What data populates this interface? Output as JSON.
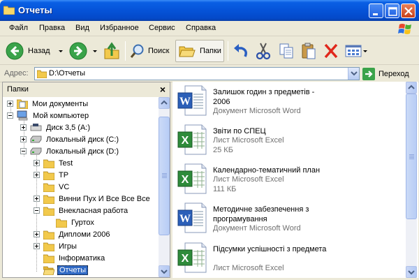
{
  "window": {
    "title": "Отчеты"
  },
  "menu": [
    "Файл",
    "Правка",
    "Вид",
    "Избранное",
    "Сервис",
    "Справка"
  ],
  "toolbar": {
    "back_label": "Назад",
    "search_label": "Поиск",
    "folders_label": "Папки"
  },
  "address": {
    "label": "Адрес:",
    "value": "D:\\Отчеты",
    "go_label": "Переход"
  },
  "folders_pane": {
    "title": "Папки",
    "items": [
      {
        "label": "Мои документы",
        "icon": "my-documents-icon"
      },
      {
        "label": "Мой компьютер",
        "icon": "my-computer-icon"
      },
      {
        "label": "Диск 3,5 (A:)",
        "icon": "floppy-drive-icon"
      },
      {
        "label": "Локальный диск (C:)",
        "icon": "hard-drive-icon"
      },
      {
        "label": "Локальный диск (D:)",
        "icon": "hard-drive-icon"
      },
      {
        "label": "Test",
        "icon": "folder-icon"
      },
      {
        "label": "TP",
        "icon": "folder-icon"
      },
      {
        "label": "VC",
        "icon": "folder-icon"
      },
      {
        "label": "Винни Пух И Все Все Все",
        "icon": "folder-icon"
      },
      {
        "label": "Внекласная работа",
        "icon": "folder-icon"
      },
      {
        "label": "Гуртох",
        "icon": "folder-icon"
      },
      {
        "label": "Дипломи 2006",
        "icon": "folder-icon"
      },
      {
        "label": "Игры",
        "icon": "folder-icon"
      },
      {
        "label": "Інформатика",
        "icon": "folder-icon"
      },
      {
        "label": "Отчеты",
        "icon": "folder-icon",
        "selected": true
      }
    ]
  },
  "files": [
    {
      "name": "Залишок годин з предметів - 2006",
      "type": "Документ Microsoft Word",
      "size": "",
      "icon": "word-document-icon"
    },
    {
      "name": "Звіти по СПЕЦ",
      "type": "Лист Microsoft Excel",
      "size": "25 КБ",
      "icon": "excel-sheet-icon"
    },
    {
      "name": "Календарно-тематичний план",
      "type": "Лист Microsoft Excel",
      "size": "111 КБ",
      "icon": "excel-sheet-icon"
    },
    {
      "name": "Методичне забезпечення з програмування",
      "type": "Документ Microsoft Word",
      "size": "",
      "icon": "word-document-icon"
    },
    {
      "name": "Підсумки успішності з предмета",
      "type": "Лист Microsoft Excel",
      "size": "",
      "icon": "excel-sheet-icon"
    }
  ],
  "colors": {
    "titlebar": "#0553d8",
    "selection": "#316AC5",
    "chrome": "#ECE9D8"
  }
}
